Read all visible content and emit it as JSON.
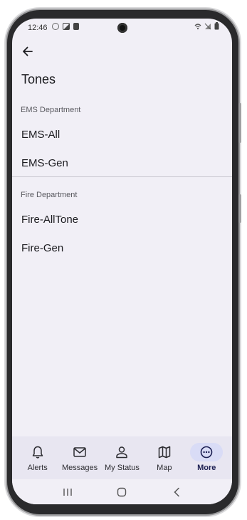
{
  "status_bar": {
    "time": "12:46",
    "left_icons": [
      "circle-status-icon",
      "image-notification-icon",
      "document-notification-icon"
    ],
    "right_icons": [
      "wifi-icon",
      "signal-icon",
      "battery-icon"
    ]
  },
  "app_bar": {
    "back_icon": "arrow-left-icon"
  },
  "page": {
    "title": "Tones"
  },
  "sections": [
    {
      "header": "EMS Department",
      "items": [
        "EMS-All",
        "EMS-Gen"
      ]
    },
    {
      "header": "Fire Department",
      "items": [
        "Fire-AllTone",
        "Fire-Gen"
      ]
    }
  ],
  "bottom_nav": {
    "items": [
      {
        "label": "Alerts",
        "icon": "bell-icon"
      },
      {
        "label": "Messages",
        "icon": "envelope-icon"
      },
      {
        "label": "My Status",
        "icon": "person-icon"
      },
      {
        "label": "Map",
        "icon": "map-icon"
      },
      {
        "label": "More",
        "icon": "more-horizontal-icon",
        "active": true
      }
    ]
  },
  "colors": {
    "background": "#f1eff6",
    "nav_background": "#e8e6f1",
    "active_pill": "#d9dcf6",
    "active_label": "#1c1f52"
  }
}
